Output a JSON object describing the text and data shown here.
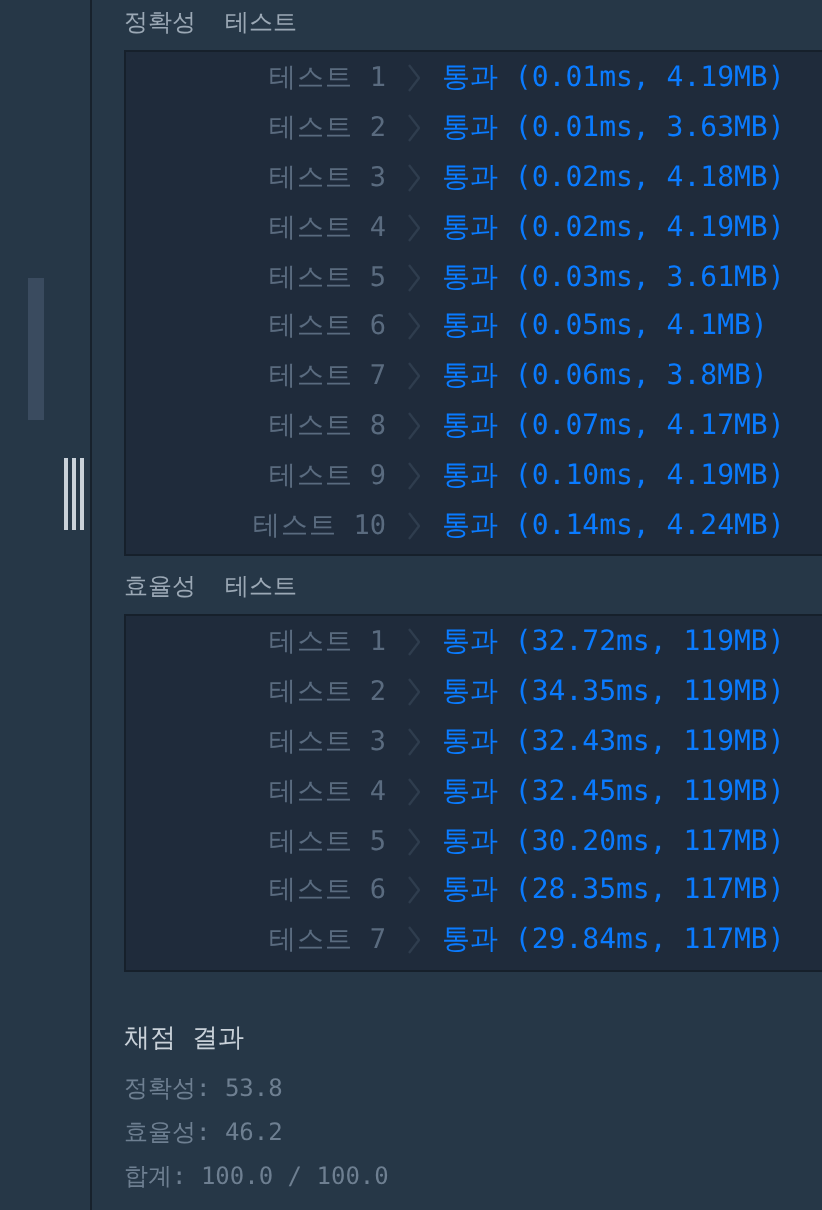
{
  "sections": [
    {
      "title": "정확성  테스트",
      "tests": [
        {
          "label": "테스트 1",
          "result": "통과 (0.01ms, 4.19MB)"
        },
        {
          "label": "테스트 2",
          "result": "통과 (0.01ms, 3.63MB)"
        },
        {
          "label": "테스트 3",
          "result": "통과 (0.02ms, 4.18MB)"
        },
        {
          "label": "테스트 4",
          "result": "통과 (0.02ms, 4.19MB)"
        },
        {
          "label": "테스트 5",
          "result": "통과 (0.03ms, 3.61MB)"
        },
        {
          "label": "테스트 6",
          "result": "통과 (0.05ms, 4.1MB)"
        },
        {
          "label": "테스트 7",
          "result": "통과 (0.06ms, 3.8MB)"
        },
        {
          "label": "테스트 8",
          "result": "통과 (0.07ms, 4.17MB)"
        },
        {
          "label": "테스트 9",
          "result": "통과 (0.10ms, 4.19MB)"
        },
        {
          "label": "테스트 10",
          "result": "통과 (0.14ms, 4.24MB)"
        }
      ]
    },
    {
      "title": "효율성  테스트",
      "tests": [
        {
          "label": "테스트 1",
          "result": "통과 (32.72ms, 119MB)"
        },
        {
          "label": "테스트 2",
          "result": "통과 (34.35ms, 119MB)"
        },
        {
          "label": "테스트 3",
          "result": "통과 (32.43ms, 119MB)"
        },
        {
          "label": "테스트 4",
          "result": "통과 (32.45ms, 119MB)"
        },
        {
          "label": "테스트 5",
          "result": "통과 (30.20ms, 117MB)"
        },
        {
          "label": "테스트 6",
          "result": "통과 (28.35ms, 117MB)"
        },
        {
          "label": "테스트 7",
          "result": "통과 (29.84ms, 117MB)"
        }
      ]
    }
  ],
  "summary": {
    "title": "채점 결과",
    "lines": [
      "정확성: 53.8",
      "효율성: 46.2",
      "합계: 100.0 / 100.0"
    ]
  }
}
